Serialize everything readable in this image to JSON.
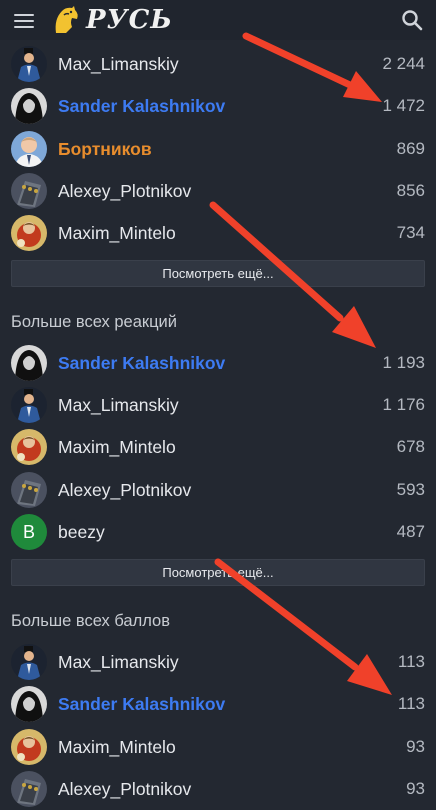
{
  "header": {
    "logo_text": "РУСЬ",
    "menu_icon": "hamburger-menu-icon",
    "search_icon": "search-icon"
  },
  "colors": {
    "background": "#232831",
    "accent_blue": "#3d7bf2",
    "accent_orange": "#e88d2d",
    "arrow_red": "#f0412a",
    "avatar_green": "#1f8a3b"
  },
  "section1": {
    "rows": [
      {
        "name": "Max_Limanskiy",
        "value": "2 244"
      },
      {
        "name": "Sander Kalashnikov",
        "value": "1 472"
      },
      {
        "name": "Бортников",
        "value": "869"
      },
      {
        "name": "Alexey_Plotnikov",
        "value": "856"
      },
      {
        "name": "Maxim_Mintelo",
        "value": "734"
      }
    ],
    "more_label": "Посмотреть ещё..."
  },
  "section2": {
    "title": "Больше всех реакций",
    "rows": [
      {
        "name": "Sander Kalashnikov",
        "value": "1 193"
      },
      {
        "name": "Max_Limanskiy",
        "value": "1 176"
      },
      {
        "name": "Maxim_Mintelo",
        "value": "678"
      },
      {
        "name": "Alexey_Plotnikov",
        "value": "593"
      },
      {
        "name": "beezy",
        "value": "487",
        "avatar_letter": "B"
      }
    ],
    "more_label": "Посмотреть ещё..."
  },
  "section3": {
    "title": "Больше всех баллов",
    "rows": [
      {
        "name": "Max_Limanskiy",
        "value": "113"
      },
      {
        "name": "Sander Kalashnikov",
        "value": "113"
      },
      {
        "name": "Maxim_Mintelo",
        "value": "93"
      },
      {
        "name": "Alexey_Plotnikov",
        "value": "93"
      }
    ]
  }
}
